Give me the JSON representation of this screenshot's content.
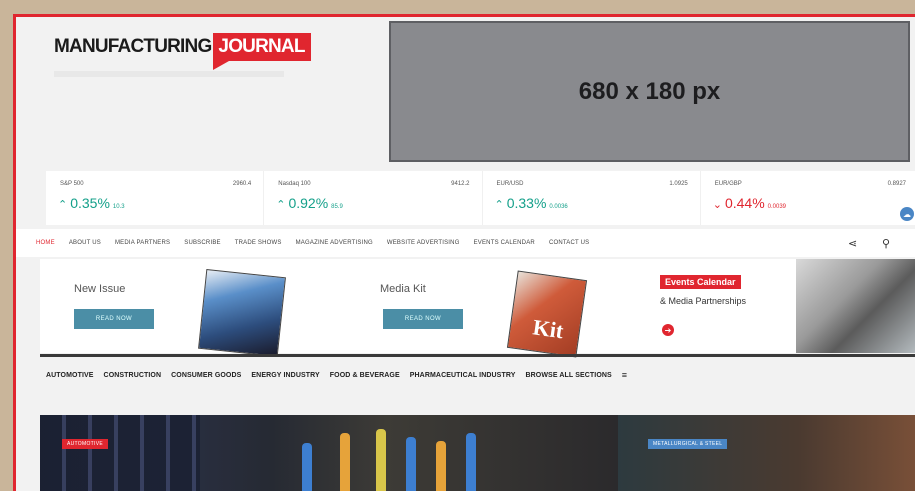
{
  "header": {
    "logo_part1": "MANUFACTURING",
    "logo_part2": "JOURNAL",
    "ad_label": "680 x 180 px"
  },
  "ticker": [
    {
      "name": "S&P 500",
      "value": "2960.4",
      "change": "0.35%",
      "sub": "10.3",
      "direction": "up"
    },
    {
      "name": "Nasdaq 100",
      "value": "9412.2",
      "change": "0.92%",
      "sub": "85.9",
      "direction": "up"
    },
    {
      "name": "EUR/USD",
      "value": "1.0925",
      "change": "0.33%",
      "sub": "0.0036",
      "direction": "up"
    },
    {
      "name": "EUR/GBP",
      "value": "0.8927",
      "change": "0.44%",
      "sub": "0.0039",
      "direction": "down"
    }
  ],
  "nav": {
    "items": [
      "HOME",
      "ABOUT US",
      "MEDIA PARTNERS",
      "SUBSCRIBE",
      "TRADE SHOWS",
      "MAGAZINE ADVERTISING",
      "WEBSITE ADVERTISING",
      "EVENTS CALENDAR",
      "CONTACT US"
    ],
    "active_index": 0
  },
  "promo": {
    "new_issue_title": "New Issue",
    "new_issue_button": "READ NOW",
    "media_kit_title": "Media Kit",
    "media_kit_button": "READ NOW",
    "media_kit_cover_text": "Kit",
    "events_tag": "Events Calendar",
    "events_sub": "& Media Partnerships"
  },
  "sections": [
    "AUTOMOTIVE",
    "CONSTRUCTION",
    "CONSUMER GOODS",
    "ENERGY INDUSTRY",
    "FOOD & BEVERAGE",
    "PHARMACEUTICAL INDUSTRY",
    "BROWSE ALL SECTIONS"
  ],
  "hero": {
    "left_badge": "AUTOMOTIVE",
    "right_badge": "METALLURGICAL & STEEL"
  },
  "colors": {
    "brand_red": "#e0262f",
    "up_green": "#14a08a",
    "button_teal": "#4b8ea6",
    "badge_blue": "#4a86c5"
  },
  "icons": [
    "share-icon",
    "search-icon",
    "menu-icon",
    "arrow-right-icon",
    "cloud-icon",
    "up-arrow-icon",
    "down-arrow-icon"
  ]
}
